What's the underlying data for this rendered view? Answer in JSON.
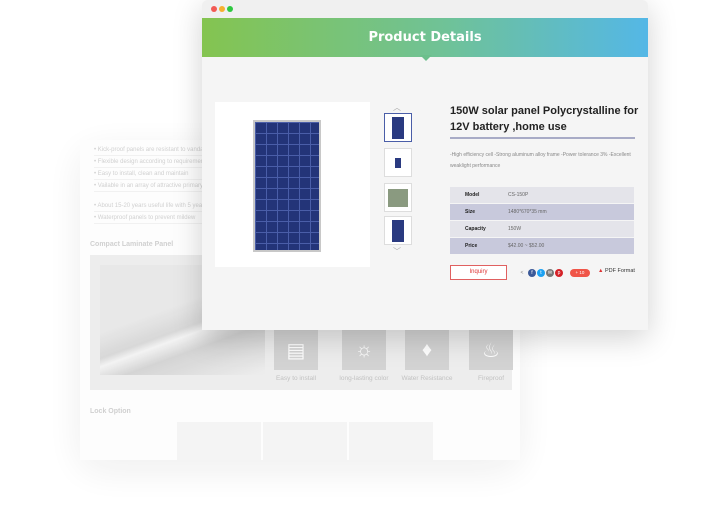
{
  "background_page": {
    "features": [
      "Kick-proof panels are resistant to vandalism",
      "Flexible design according to requirements",
      "Easy to install, clean and maintain",
      "Vailable in an array of attractive primary colors",
      "About 15-20 years useful life with 5 years warranty",
      "Waterproof panels to prevent mildew"
    ],
    "laminate_heading": "Compact Laminate Panel",
    "icons": [
      {
        "icon": "brick-wall-icon",
        "label": "Easy to install"
      },
      {
        "icon": "sun-icon",
        "label": "long-lasting color"
      },
      {
        "icon": "water-drop-icon",
        "label": "Water Resistance"
      },
      {
        "icon": "fire-icon",
        "label": "Fireproof"
      }
    ],
    "lock_heading": "Lock Option"
  },
  "window": {
    "header_title": "Product Details",
    "header_gradient": [
      "#84c450",
      "#54b7e6"
    ],
    "product": {
      "title": "150W solar panel Polycrystalline for 12V battery ,home use",
      "description": "-High efficiency cell  -Strong aluminum alloy frame  -Power tolerance 3%  -Excellent weaklight performance",
      "specs": [
        {
          "label": "Model",
          "value": "CS-150P"
        },
        {
          "label": "Size",
          "value": "1480*670*35 mm"
        },
        {
          "label": "Capacity",
          "value": "150W"
        },
        {
          "label": "Price",
          "value": "$42.00 ~ $52.00"
        }
      ],
      "inquiry_label": "Inquiry",
      "share_count": "+ 10",
      "pdf_label": "PDF Format"
    }
  }
}
